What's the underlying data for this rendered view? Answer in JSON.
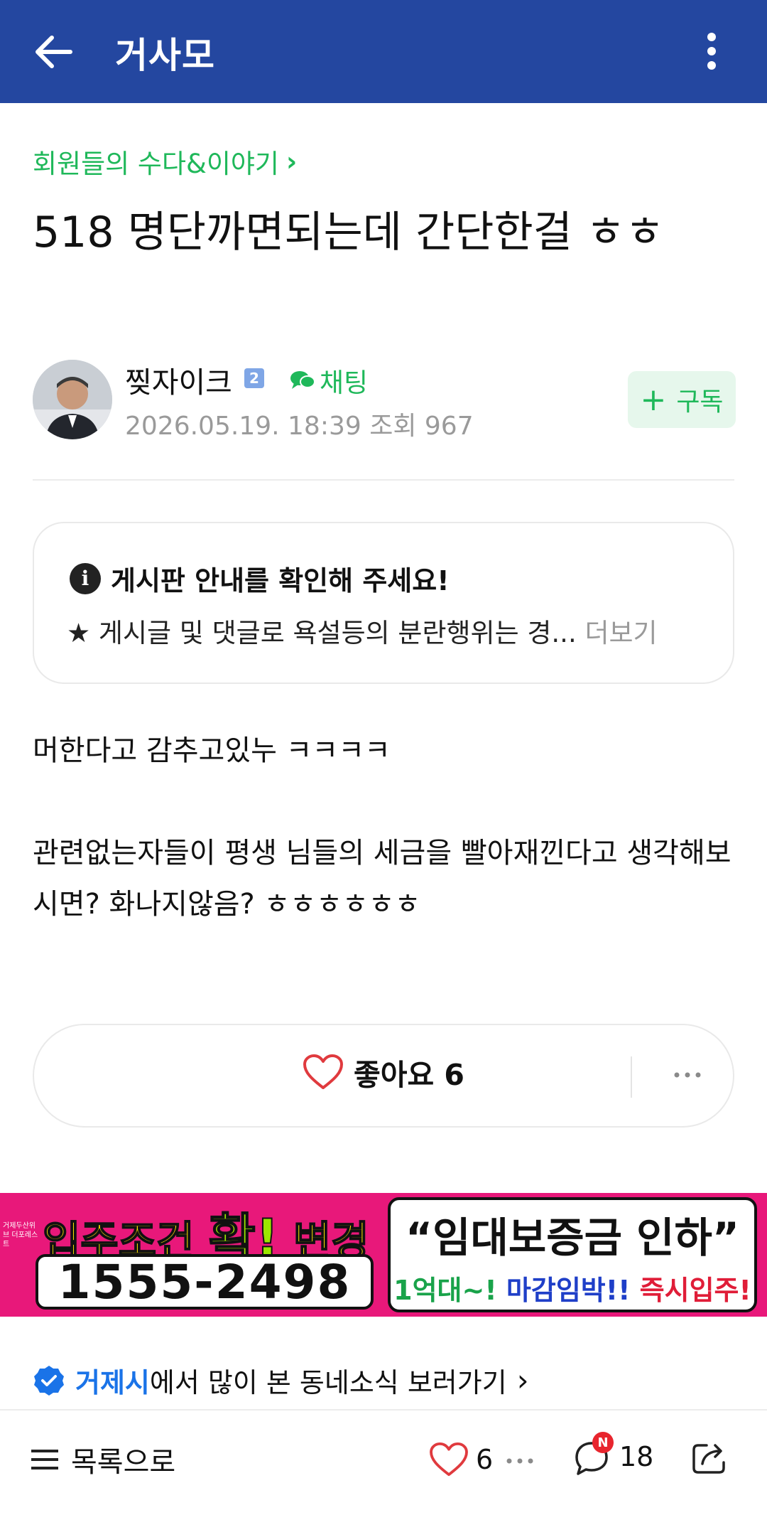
{
  "appbar": {
    "title": "거사모",
    "back_icon": "arrow-left-icon",
    "more_icon": "vertical-dots-icon"
  },
  "breadcrumb": {
    "label": "회원들의 수다&이야기",
    "chevron": "›"
  },
  "post": {
    "title": "518 명단까면되는데 간단한걸 ㅎㅎ",
    "author": "찢자이크",
    "level": "2",
    "chat_label": "채팅",
    "meta": "2026.05.19. 18:39  조회 967",
    "subscribe_label": "구독",
    "subscribe_plus": "+",
    "body": [
      "머한다고 감추고있누 ㅋㅋㅋㅋ",
      "관련없는자들이 평생 님들의 세금을 빨아재낀다고 생각해보시면? 화나지않음? ㅎㅎㅎㅎㅎㅎ"
    ]
  },
  "notice": {
    "title": "게시판 안내를 확인해 주세요!",
    "body": "★ 게시글 및 댓글로 욕설등의 분란행위는 경...",
    "more": "더보기",
    "icon_letter": "i"
  },
  "actions": {
    "like_label": "좋아요 6"
  },
  "ad": {
    "small_text": "거제두산위브 더포레스트",
    "line1_pre": "입주조건 ",
    "line1_hl": "확!",
    "line1_post": " 변경",
    "phone": "1555-2498",
    "right_top": "“임대보증금 인하”",
    "right_b1": "1억대~! ",
    "right_b2": "마감임박!! ",
    "right_b3": "즉시입주!"
  },
  "neighbor": {
    "city": "거제시",
    "text": "에서 많이 본 동네소식 보러가기",
    "chevron": "›"
  },
  "bottom": {
    "list_label": "목록으로",
    "like_count": "6",
    "comment_count": "18",
    "new_badge": "N"
  },
  "colors": {
    "appbar": "#2447a0",
    "accent_green": "#1fb85a",
    "like_red": "#e03a3e",
    "link_blue": "#1a73e8"
  }
}
